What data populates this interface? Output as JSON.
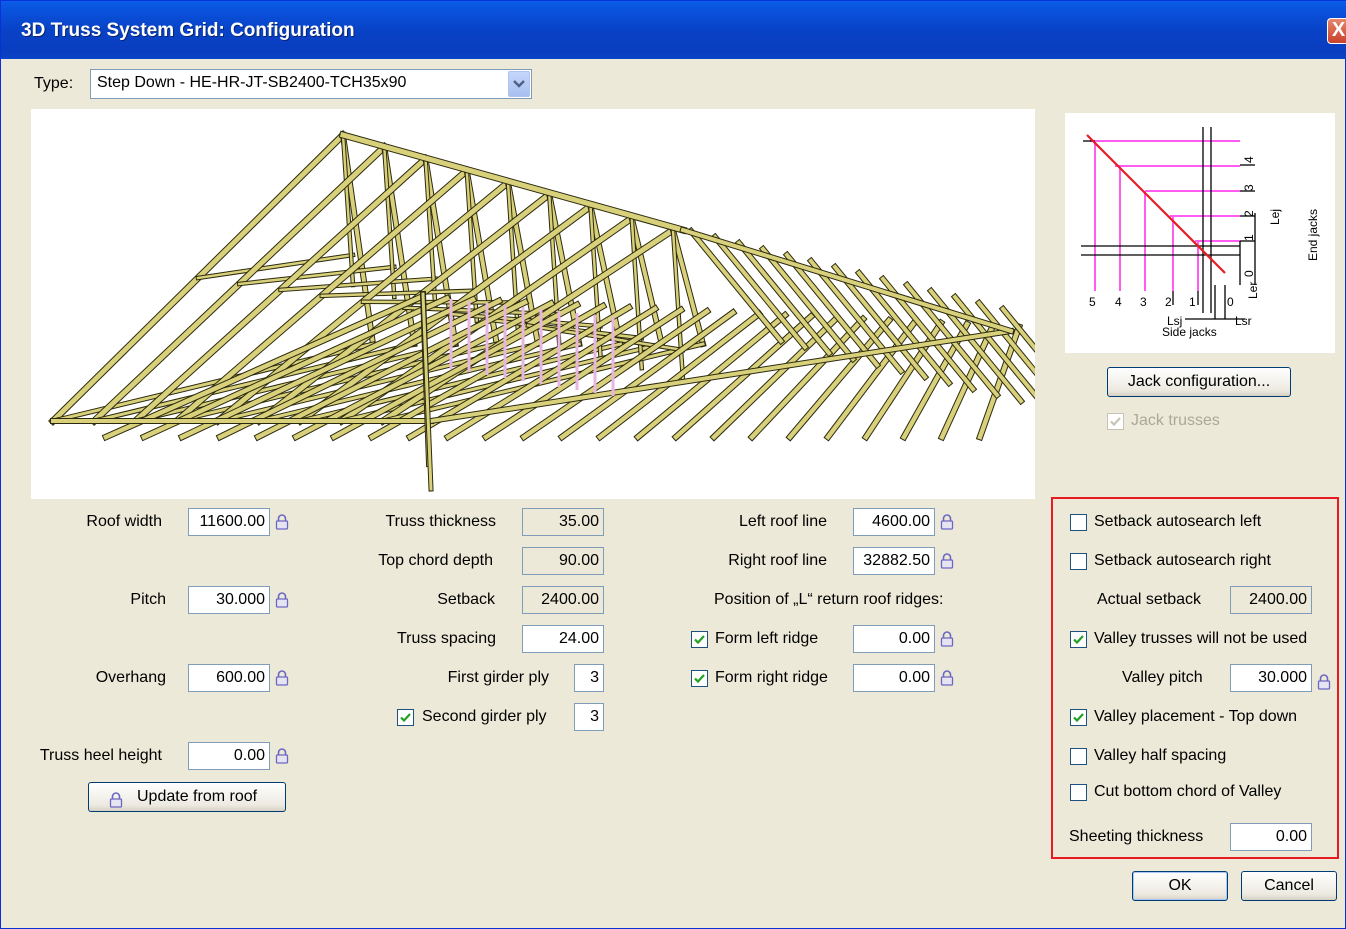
{
  "window": {
    "title": "3D Truss System Grid: Configuration",
    "close_glyph": "X"
  },
  "type": {
    "label": "Type:",
    "value": "Step Down - HE-HR-JT-SB2400-TCH35x90"
  },
  "jack": {
    "config_button": "Jack configuration...",
    "jack_trusses_label": "Jack trusses",
    "jack_trusses_checked": true,
    "diagram": {
      "side_label": "Side jacks",
      "end_label": "End jacks",
      "lsj": "Lsj",
      "lsr": "Lsr",
      "lej": "Lej",
      "ler": "Ler",
      "side_ticks": [
        "5",
        "4",
        "3",
        "2",
        "1",
        "0"
      ],
      "end_ticks": [
        "4",
        "3",
        "2",
        "1",
        "0"
      ]
    }
  },
  "left": {
    "roof_width_label": "Roof width",
    "roof_width": "11600.00",
    "pitch_label": "Pitch",
    "pitch": "30.000",
    "overhang_label": "Overhang",
    "overhang": "600.00",
    "heel_label": "Truss heel height",
    "heel": "0.00",
    "update_button": "Update from roof"
  },
  "middle": {
    "thickness_label": "Truss thickness",
    "thickness": "35.00",
    "chord_label": "Top chord depth",
    "chord": "90.00",
    "setback_label": "Setback",
    "setback": "2400.00",
    "spacing_label": "Truss spacing",
    "spacing": "24.00",
    "first_ply_label": "First girder ply",
    "first_ply": "3",
    "second_ply_label": "Second girder ply",
    "second_ply": "3",
    "second_ply_checked": true
  },
  "right": {
    "left_roof_label": "Left roof line",
    "left_roof": "4600.00",
    "right_roof_label": "Right roof line",
    "right_roof": "32882.50",
    "position_label": "Position of „L“ return roof ridges:",
    "form_left_label": "Form left ridge",
    "form_left": "0.00",
    "form_left_checked": true,
    "form_right_label": "Form right ridge",
    "form_right": "0.00",
    "form_right_checked": true
  },
  "options": {
    "autosearch_left": "Setback autosearch left",
    "autosearch_left_checked": false,
    "autosearch_right": "Setback autosearch right",
    "autosearch_right_checked": false,
    "actual_setback_label": "Actual setback",
    "actual_setback": "2400.00",
    "valley_not_used": "Valley trusses will not be used",
    "valley_not_used_checked": true,
    "valley_pitch_label": "Valley pitch",
    "valley_pitch": "30.000",
    "valley_top_down": "Valley placement - Top down",
    "valley_top_down_checked": true,
    "valley_half": "Valley half spacing",
    "valley_half_checked": false,
    "cut_bottom": "Cut bottom chord of Valley",
    "cut_bottom_checked": false,
    "sheeting_label": "Sheeting thickness",
    "sheeting": "0.00"
  },
  "buttons": {
    "ok": "OK",
    "cancel": "Cancel"
  },
  "colors": {
    "title_bar": "#0a46c9",
    "dialog_bg": "#ece9d8",
    "truss": "#d8d07a",
    "highlight_box": "#e81a22",
    "jack_grid": "#ff5cf2",
    "jack_line": "#e81a22"
  }
}
